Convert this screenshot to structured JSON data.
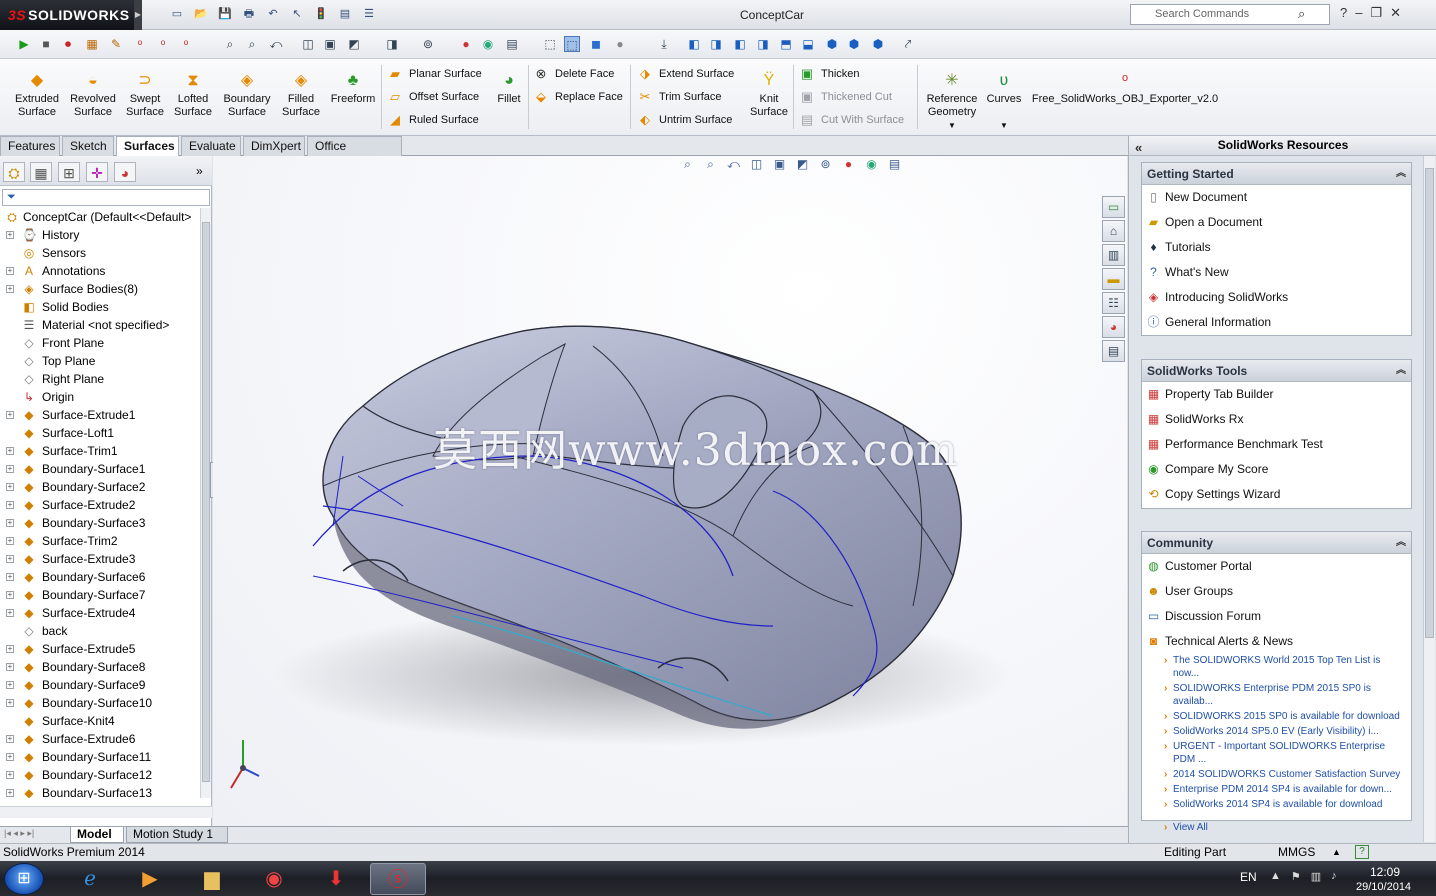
{
  "app": {
    "logo_text": "SOLIDWORKS",
    "document_title": "ConceptCar",
    "search_placeholder": "Search Commands",
    "help_glyph": "?",
    "win_min": "–",
    "win_restore": "❐",
    "win_close": "✕"
  },
  "command_manager": {
    "big_commands": [
      {
        "label1": "Extruded",
        "label2": "Surface"
      },
      {
        "label1": "Revolved",
        "label2": "Surface"
      },
      {
        "label1": "Swept",
        "label2": "Surface"
      },
      {
        "label1": "Lofted",
        "label2": "Surface"
      },
      {
        "label1": "Boundary",
        "label2": "Surface"
      },
      {
        "label1": "Filled",
        "label2": "Surface"
      },
      {
        "label1": "Freeform",
        "label2": ""
      }
    ],
    "planar_surface": "Planar Surface",
    "offset_surface": "Offset Surface",
    "ruled_surface": "Ruled Surface",
    "fillet": "Fillet",
    "delete_face": "Delete Face",
    "replace_face": "Replace Face",
    "extend_surface": "Extend Surface",
    "trim_surface": "Trim Surface",
    "untrim_surface": "Untrim Surface",
    "knit_label1": "Knit",
    "knit_label2": "Surface",
    "thicken": "Thicken",
    "thickened_cut": "Thickened Cut",
    "cut_with_surface": "Cut With Surface",
    "ref_geom_label1": "Reference",
    "ref_geom_label2": "Geometry",
    "curves": "Curves",
    "obj_exporter": "Free_SolidWorks_OBJ_Exporter_v2.0"
  },
  "tabs": [
    "Features",
    "Sketch",
    "Surfaces",
    "Evaluate",
    "DimXpert",
    "Office Products"
  ],
  "active_tab": "Surfaces",
  "feature_tree": {
    "root": "ConceptCar  (Default<<Default>",
    "items": [
      "History",
      "Sensors",
      "Annotations",
      "Surface Bodies(8)",
      "Solid Bodies",
      "Material <not specified>",
      "Front Plane",
      "Top Plane",
      "Right Plane",
      "Origin",
      "Surface-Extrude1",
      "Surface-Loft1",
      "Surface-Trim1",
      "Boundary-Surface1",
      "Boundary-Surface2",
      "Surface-Extrude2",
      "Boundary-Surface3",
      "Surface-Trim2",
      "Surface-Extrude3",
      "Boundary-Surface6",
      "Boundary-Surface7",
      "Surface-Extrude4",
      "back",
      "Surface-Extrude5",
      "Boundary-Surface8",
      "Boundary-Surface9",
      "Boundary-Surface10",
      "Surface-Knit4",
      "Surface-Extrude6",
      "Boundary-Surface11",
      "Boundary-Surface12",
      "Boundary-Surface13"
    ]
  },
  "graphics": {
    "watermark": "莫西网www.3dmox.com"
  },
  "bottom_tabs": [
    "Model",
    "Motion Study 1"
  ],
  "task_pane": {
    "title": "SolidWorks Resources",
    "getting_started": {
      "title": "Getting Started",
      "items": [
        "New Document",
        "Open a Document",
        "Tutorials",
        "What's New",
        "Introducing SolidWorks",
        "General Information"
      ]
    },
    "tools": {
      "title": "SolidWorks Tools",
      "items": [
        "Property Tab Builder",
        "SolidWorks Rx",
        "Performance Benchmark Test",
        "Compare My Score",
        "Copy Settings Wizard"
      ]
    },
    "community": {
      "title": "Community",
      "items": [
        "Customer Portal",
        "User Groups",
        "Discussion Forum",
        "Technical Alerts & News"
      ],
      "news": [
        "The SOLIDWORKS World 2015 Top Ten List is now...",
        "SOLIDWORKS Enterprise PDM 2015 SP0 is availab...",
        "SOLIDWORKS 2015 SP0 is available for download",
        "SolidWorks 2014 SP5.0 EV (Early Visibility) i...",
        "URGENT - Important SOLIDWORKS Enterprise PDM ...",
        "2014 SOLIDWORKS Customer Satisfaction Survey",
        "Enterprise PDM 2014 SP4 is available for down...",
        "SolidWorks 2014 SP4 is available for download"
      ],
      "view_all": "View All"
    }
  },
  "status": {
    "product": "SolidWorks Premium 2014",
    "editing": "Editing Part",
    "units": "MMGS",
    "units_arrow": "▲",
    "help": "?"
  },
  "taskbar": {
    "lang": "EN",
    "time": "12:09",
    "date": "29/10/2014"
  }
}
